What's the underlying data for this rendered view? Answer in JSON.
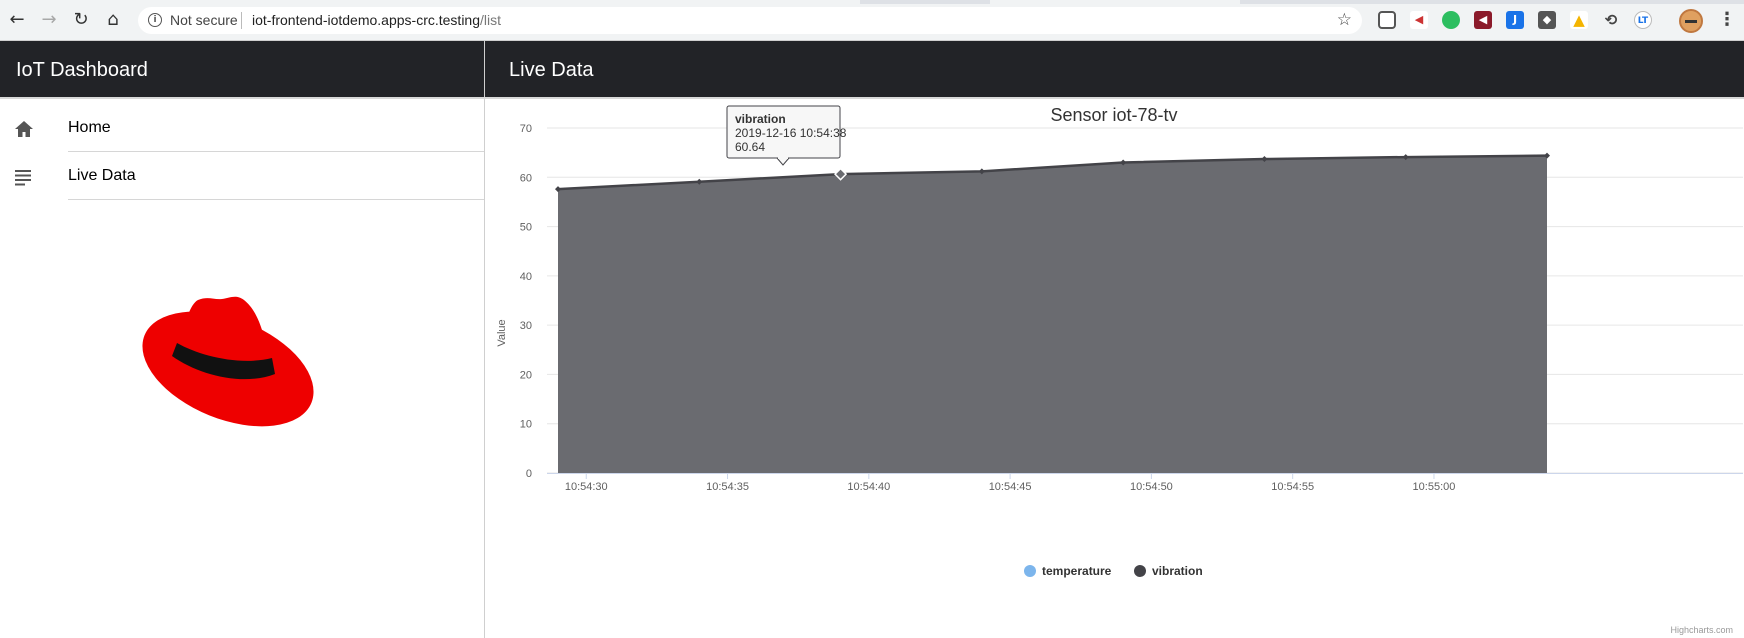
{
  "browser": {
    "security_label": "Not secure",
    "url_host": "iot-frontend-iotdemo.apps-crc.testing",
    "url_path": "/list",
    "back_icon": "arrow-left-icon",
    "forward_icon": "arrow-right-icon",
    "reload_icon": "reload-icon",
    "home_icon": "home-icon"
  },
  "app": {
    "title": "IoT Dashboard",
    "page_title": "Live Data"
  },
  "sidebar": {
    "items": [
      {
        "label": "Home",
        "icon": "home-icon"
      },
      {
        "label": "Live Data",
        "icon": "list-icon"
      }
    ]
  },
  "logo": {
    "name": "red-hat-logo",
    "brand_color": "#ee0000"
  },
  "chart_data": {
    "type": "area",
    "title": "Sensor iot-78-tv",
    "ylabel": "Value",
    "ylim": [
      0,
      70
    ],
    "yticks": [
      "0",
      "10",
      "20",
      "30",
      "40",
      "50",
      "60",
      "70"
    ],
    "xticks": [
      "10:54:30",
      "10:54:35",
      "10:54:40",
      "10:54:45",
      "10:54:50",
      "10:54:55",
      "10:55:00"
    ],
    "xtick_seconds": [
      30,
      35,
      40,
      45,
      50,
      55,
      60
    ],
    "xlim_seconds": [
      29,
      64
    ],
    "series": [
      {
        "name": "temperature",
        "color": "#7cb5ec",
        "x": [],
        "values": []
      },
      {
        "name": "vibration",
        "color": "#434348",
        "x": [
          "10:54:28",
          "10:54:33",
          "10:54:38",
          "10:54:43",
          "10:54:48",
          "10:54:53",
          "10:54:58",
          "10:55:03"
        ],
        "x_seconds": [
          29,
          34,
          39,
          44,
          49,
          54,
          59,
          64
        ],
        "values": [
          57.6,
          59.1,
          60.64,
          61.2,
          63.0,
          63.7,
          64.1,
          64.4
        ]
      }
    ],
    "legend": "bottom-center",
    "grid": true,
    "tooltip": {
      "series": "vibration",
      "time": "2019-12-16 10:54:38",
      "value": "60.64"
    },
    "credits": "Highcharts.com"
  }
}
